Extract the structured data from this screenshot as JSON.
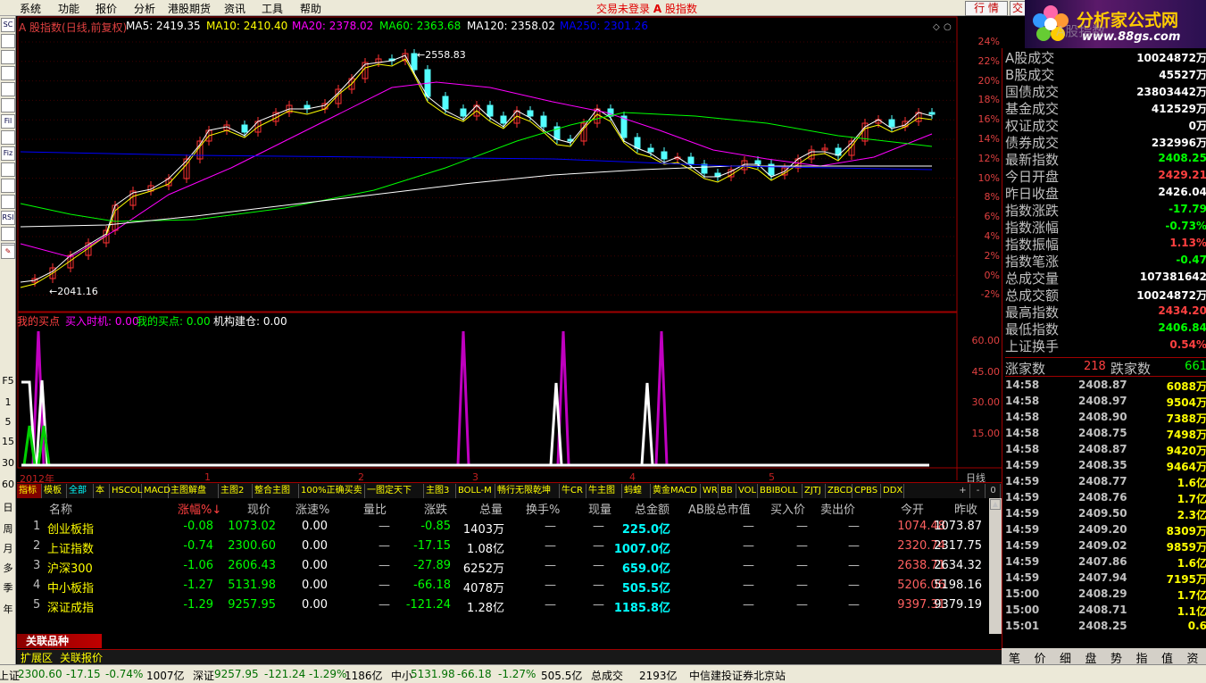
{
  "menu": {
    "items": [
      "系统",
      "功能",
      "报价",
      "分析",
      "港股期货",
      "资讯",
      "工具",
      "帮助"
    ],
    "status": "交易未登录",
    "title_icon": "A",
    "title": "股指数",
    "btn_quote": "行 情",
    "btn_trade": "交"
  },
  "logo": {
    "name": "分析家公式网",
    "url": "www.88gs.com"
  },
  "left_toolbar": [
    "SC",
    "",
    "",
    "",
    "",
    "",
    "Fil",
    "",
    "Fiz",
    "",
    "",
    "",
    "RSI",
    "",
    "",
    "",
    "F5",
    "1",
    "5",
    "15",
    "30",
    "60",
    "日",
    "周",
    "月",
    "多",
    "季",
    "年"
  ],
  "chart": {
    "title": "A 股指数(日线,前复权)",
    "ma": [
      {
        "label": "MA5: 2419.35",
        "color": "#ffffff"
      },
      {
        "label": "MA10: 2410.40",
        "color": "#ffff00"
      },
      {
        "label": "MA20: 2378.02",
        "color": "#ff00ff"
      },
      {
        "label": "MA60: 2363.68",
        "color": "#00ff00"
      },
      {
        "label": "MA120: 2358.02",
        "color": "#ffffff"
      },
      {
        "label": "MA250: 2301.26",
        "color": "#0000ff"
      }
    ],
    "high_label": "2558.83",
    "low_label": "2041.16",
    "y_labels": [
      "24%",
      "22%",
      "20%",
      "18%",
      "16%",
      "14%",
      "12%",
      "10%",
      "8%",
      "6%",
      "4%",
      "2%",
      "0%",
      "-2%"
    ],
    "indicator": {
      "name": "我的买点",
      "items": [
        {
          "label": "买入时机: 0.00",
          "color": "#ff00ff"
        },
        {
          "label": "我的买点: 0.00",
          "color": "#00ff00"
        },
        {
          "label": "机构建仓: 0.00",
          "color": "#ffffff"
        }
      ],
      "y_labels": [
        "60.00",
        "45.00",
        "30.00",
        "15.00"
      ]
    },
    "x_labels": [
      "2012年",
      "1",
      "2",
      "3",
      "4",
      "5"
    ],
    "period": "日线"
  },
  "tabs": [
    "指标",
    "模板",
    "全部",
    "本",
    "HSCOL",
    "MACD",
    "主图解盘",
    "主图2",
    "整合主图",
    "100%正确买卖",
    "一图定天下",
    "主图3",
    "BOLL-M",
    "畅行无限乾坤",
    "牛CR",
    "牛主图",
    "蚂蝗",
    "黄金MACD",
    "WR",
    "BB",
    "VOL",
    "BBIBOLL",
    "ZJTJ",
    "ZBCD",
    "CPBS",
    "DDX"
  ],
  "tab_controls": [
    "+",
    "-",
    "0"
  ],
  "table": {
    "headers": [
      "名称",
      "涨幅%↓",
      "现价",
      "涨速%",
      "量比",
      "涨跌",
      "总量",
      "换手%",
      "现量",
      "总金额",
      "AB股总市值",
      "买入价",
      "卖出价",
      "今开",
      "昨收"
    ],
    "rows": [
      [
        "1",
        "创业板指",
        "-0.08",
        "1073.02",
        "0.00",
        "—",
        "-0.85",
        "1403万",
        "—",
        "—",
        "225.0亿",
        "—",
        "—",
        "—",
        "1074.48",
        "1073.87"
      ],
      [
        "2",
        "上证指数",
        "-0.74",
        "2300.60",
        "0.00",
        "—",
        "-17.15",
        "1.08亿",
        "—",
        "—",
        "1007.0亿",
        "—",
        "—",
        "—",
        "2320.74",
        "2317.75"
      ],
      [
        "3",
        "沪深300",
        "-1.06",
        "2606.43",
        "0.00",
        "—",
        "-27.89",
        "6252万",
        "—",
        "—",
        "659.0亿",
        "—",
        "—",
        "—",
        "2638.71",
        "2634.32"
      ],
      [
        "4",
        "中小板指",
        "-1.27",
        "5131.98",
        "0.00",
        "—",
        "-66.18",
        "4078万",
        "—",
        "—",
        "505.5亿",
        "—",
        "—",
        "—",
        "5206.06",
        "5198.16"
      ],
      [
        "5",
        "深证成指",
        "-1.29",
        "9257.95",
        "0.00",
        "—",
        "-121.24",
        "1.28亿",
        "—",
        "—",
        "1185.8亿",
        "—",
        "—",
        "—",
        "9397.31",
        "9379.19"
      ]
    ]
  },
  "bottom": {
    "related_title": "关联品种",
    "tab1": "扩展区",
    "tab2": "关联报价"
  },
  "right": {
    "head_text": "A股指数",
    "rows": [
      {
        "label": "A股成交",
        "value": "10024872万",
        "color": "#ffffff"
      },
      {
        "label": "B股成交",
        "value": "45527万",
        "color": "#ffffff"
      },
      {
        "label": "国债成交",
        "value": "23803442万",
        "color": "#ffffff"
      },
      {
        "label": "基金成交",
        "value": "412529万",
        "color": "#ffffff"
      },
      {
        "label": "权证成交",
        "value": "0万",
        "color": "#ffffff"
      },
      {
        "label": "债券成交",
        "value": "232996万",
        "color": "#ffffff"
      },
      {
        "label": "最新指数",
        "value": "2408.25",
        "color": "#00ff00"
      },
      {
        "label": "今日开盘",
        "value": "2429.21",
        "color": "#ff4040"
      },
      {
        "label": "昨日收盘",
        "value": "2426.04",
        "color": "#ffffff"
      },
      {
        "label": "指数涨跌",
        "value": "-17.79",
        "color": "#00ff00"
      },
      {
        "label": "指数涨幅",
        "value": "-0.73%",
        "color": "#00ff00"
      },
      {
        "label": "指数振幅",
        "value": "1.13%",
        "color": "#ff4040"
      },
      {
        "label": "指数笔涨",
        "value": "-0.47",
        "color": "#00ff00"
      },
      {
        "label": "总成交量",
        "value": "107381642",
        "color": "#ffffff"
      },
      {
        "label": "总成交额",
        "value": "10024872万",
        "color": "#ffffff"
      },
      {
        "label": "最高指数",
        "value": "2434.20",
        "color": "#ff4040"
      },
      {
        "label": "最低指数",
        "value": "2406.84",
        "color": "#00ff00"
      },
      {
        "label": "上证换手",
        "value": "0.54%",
        "color": "#ff4040"
      }
    ],
    "updown": {
      "up_label": "涨家数",
      "up_value": "218",
      "down_label": "跌家数",
      "down_value": "661"
    },
    "ticks": [
      [
        "14:58",
        "2408.87",
        "6088万"
      ],
      [
        "14:58",
        "2408.97",
        "9504万"
      ],
      [
        "14:58",
        "2408.90",
        "7388万"
      ],
      [
        "14:58",
        "2408.75",
        "7498万"
      ],
      [
        "14:58",
        "2408.87",
        "9420万"
      ],
      [
        "14:59",
        "2408.35",
        "9464万"
      ],
      [
        "14:59",
        "2408.77",
        "1.6亿"
      ],
      [
        "14:59",
        "2408.76",
        "1.7亿"
      ],
      [
        "14:59",
        "2409.50",
        "2.3亿"
      ],
      [
        "14:59",
        "2409.20",
        "8309万"
      ],
      [
        "14:59",
        "2409.02",
        "9859万"
      ],
      [
        "14:59",
        "2407.86",
        "1.6亿"
      ],
      [
        "14:59",
        "2407.94",
        "7195万"
      ],
      [
        "15:00",
        "2408.29",
        "1.7亿"
      ],
      [
        "15:00",
        "2408.71",
        "1.1亿"
      ],
      [
        "15:01",
        "2408.25",
        "0.6"
      ]
    ],
    "tabs": [
      "笔",
      "价",
      "细",
      "盘",
      "势",
      "指",
      "值",
      "资"
    ]
  },
  "statusbar": [
    {
      "text": "上证",
      "color": "#000"
    },
    {
      "text": "2300.60",
      "color": "#007000"
    },
    {
      "text": "-17.15",
      "color": "#007000"
    },
    {
      "text": "-0.74%",
      "color": "#007000"
    },
    {
      "text": "1007亿",
      "color": "#000"
    },
    {
      "text": "深证",
      "color": "#000"
    },
    {
      "text": "9257.95",
      "color": "#007000"
    },
    {
      "text": "-121.24",
      "color": "#007000"
    },
    {
      "text": "-1.29%",
      "color": "#007000"
    },
    {
      "text": "1186亿",
      "color": "#000"
    },
    {
      "text": "中小",
      "color": "#000"
    },
    {
      "text": "5131.98",
      "color": "#007000"
    },
    {
      "text": "-66.18",
      "color": "#007000"
    },
    {
      "text": "-1.27%",
      "color": "#007000"
    },
    {
      "text": "505.5亿",
      "color": "#000"
    },
    {
      "text": "总成交",
      "color": "#000"
    },
    {
      "text": "2193亿",
      "color": "#000"
    },
    {
      "text": "中信建投证券北京站",
      "color": "#000"
    }
  ]
}
